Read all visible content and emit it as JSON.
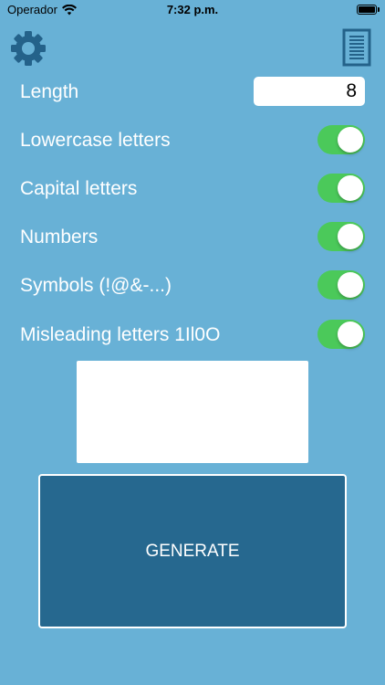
{
  "status_bar": {
    "carrier": "Operador",
    "time": "7:32 p.m."
  },
  "toolbar": {
    "settings_icon": "gear-icon",
    "list_icon": "document-list-icon"
  },
  "length": {
    "label": "Length",
    "value": "8"
  },
  "options": [
    {
      "label": "Lowercase letters",
      "enabled": true
    },
    {
      "label": "Capital letters",
      "enabled": true
    },
    {
      "label": "Numbers",
      "enabled": true
    },
    {
      "label": "Symbols (!@&-...)",
      "enabled": true
    },
    {
      "label": "Misleading letters 1Il0O",
      "enabled": true
    }
  ],
  "output": {
    "value": ""
  },
  "generate_button": {
    "label": "GENERATE"
  },
  "colors": {
    "background": "#68b1d6",
    "toggle_on": "#4bc95a",
    "button": "#26688f",
    "icon": "#24628a"
  }
}
